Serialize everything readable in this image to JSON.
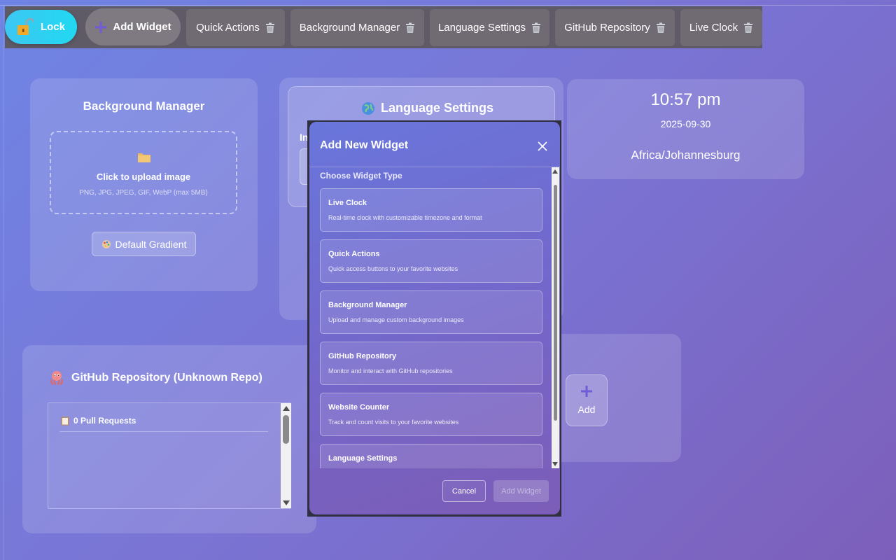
{
  "toolbar": {
    "lock_label": "Lock",
    "add_widget_label": "Add Widget",
    "tabs": [
      {
        "label": "Quick Actions"
      },
      {
        "label": "Background Manager"
      },
      {
        "label": "Language Settings"
      },
      {
        "label": "GitHub Repository"
      },
      {
        "label": "Live Clock"
      }
    ]
  },
  "background_manager": {
    "title": "Background Manager",
    "upload_label": "Click to upload image",
    "upload_hint": "PNG, JPG, JPEG, GIF, WebP (max 5MB)",
    "default_gradient_label": "Default Gradient"
  },
  "language_settings": {
    "title": "Language Settings",
    "label_fragment": "In"
  },
  "clock": {
    "time": "10:57 pm",
    "date": "2025-09-30",
    "timezone": "Africa/Johannesburg"
  },
  "github": {
    "title": "GitHub Repository (Unknown Repo)",
    "pull_requests": "0 Pull Requests"
  },
  "quick_actions": {
    "add_label": "Add"
  },
  "modal": {
    "title": "Add New Widget",
    "subtitle": "Choose Widget Type",
    "options": [
      {
        "title": "Live Clock",
        "desc": "Real-time clock with customizable timezone and format"
      },
      {
        "title": "Quick Actions",
        "desc": "Quick access buttons to your favorite websites"
      },
      {
        "title": "Background Manager",
        "desc": "Upload and manage custom background images"
      },
      {
        "title": "GitHub Repository",
        "desc": "Monitor and interact with GitHub repositories"
      },
      {
        "title": "Website Counter",
        "desc": "Track and count visits to your favorite websites"
      },
      {
        "title": "Language Settings",
        "desc": ""
      }
    ],
    "cancel_label": "Cancel",
    "add_label": "Add Widget"
  },
  "colors": {
    "lock_accent": "#21d8f0",
    "toolbar_bg": "#5e5a66",
    "plus_icon": "#6f5cd6"
  }
}
